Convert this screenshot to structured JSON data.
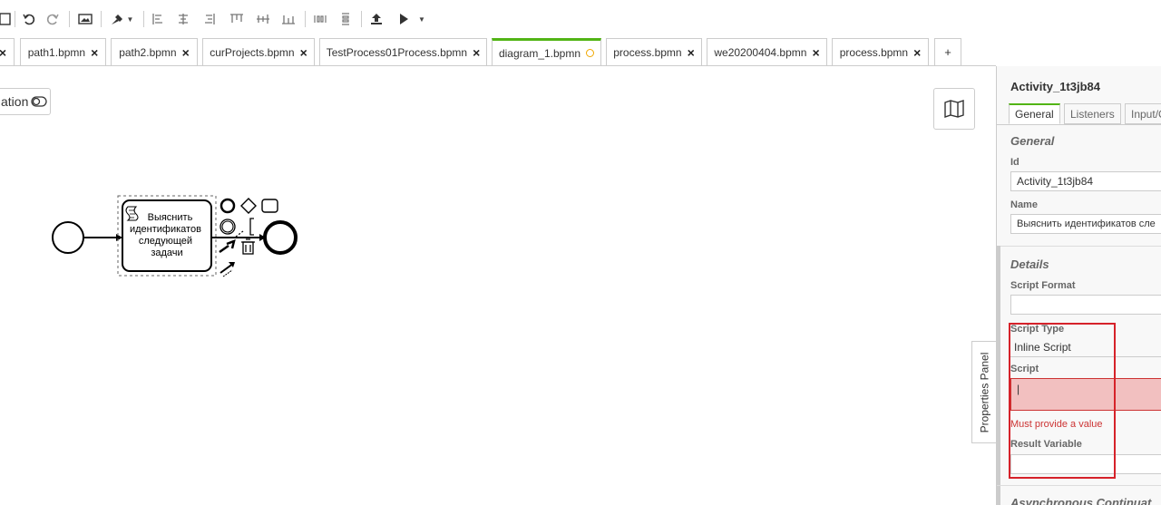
{
  "toolbar": {
    "icons": [
      "save-icon",
      "undo-icon",
      "redo-icon",
      "image-icon",
      "color-icon",
      "align-left-icon",
      "align-center-icon",
      "align-right-icon",
      "align-top-icon",
      "align-middle-icon",
      "align-bottom-icon",
      "distribute-horizontal-icon",
      "distribute-vertical-icon",
      "deploy-icon",
      "run-icon"
    ]
  },
  "tabs": [
    {
      "label": "path1.bpmn"
    },
    {
      "label": "path2.bpmn"
    },
    {
      "label": "curProjects.bpmn"
    },
    {
      "label": "TestProcess01Process.bpmn"
    },
    {
      "label": "diagram_1.bpmn",
      "active": true
    },
    {
      "label": "process.bpmn"
    },
    {
      "label": "we20200404.bpmn"
    },
    {
      "label": "process.bpmn"
    }
  ],
  "canvas": {
    "mode_label": "ation",
    "task_text": [
      "Выяснить",
      "идентификатов",
      "следующей",
      "задачи"
    ]
  },
  "properties_toggle": "Properties Panel",
  "panel": {
    "title": "Activity_1t3jb84",
    "tabs": [
      "General",
      "Listeners",
      "Input/O"
    ],
    "general": {
      "heading": "General",
      "id_label": "Id",
      "id_value": "Activity_1t3jb84",
      "name_label": "Name",
      "name_value": "Выяснить идентификатов сле"
    },
    "details": {
      "heading": "Details",
      "script_format_label": "Script Format",
      "script_format_value": "",
      "script_type_label": "Script Type",
      "script_type_value": "Inline Script",
      "script_label": "Script",
      "script_value": "|",
      "error": "Must provide a value",
      "result_variable_label": "Result Variable",
      "result_variable_value": ""
    },
    "next_heading": "Asynchronous Continuat"
  },
  "colors": {
    "accent": "#52b415",
    "error": "#cc3333",
    "highlight": "#d6222a"
  }
}
